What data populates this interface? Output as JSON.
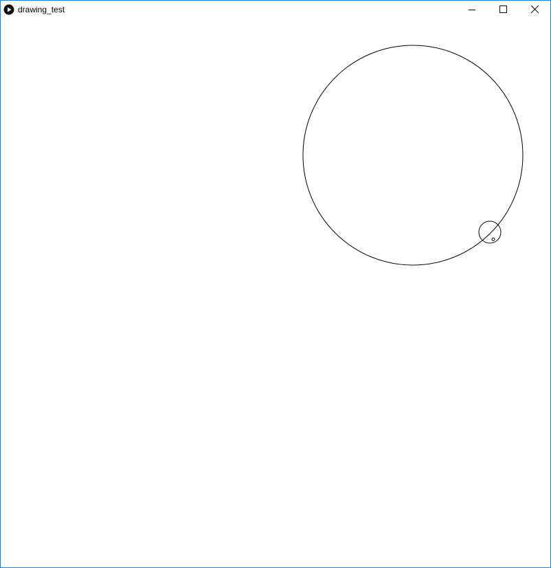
{
  "window": {
    "title": "drawing_test",
    "border_color": "#1883d7",
    "title_icon": "processing-play-icon"
  },
  "controls": {
    "minimize": "minimize-icon",
    "maximize": "maximize-icon",
    "close": "close-icon"
  },
  "canvas": {
    "background": "#ffffff",
    "stroke": "#000000",
    "shapes": [
      "large-circle",
      "small-circle",
      "tiny-circle"
    ]
  }
}
